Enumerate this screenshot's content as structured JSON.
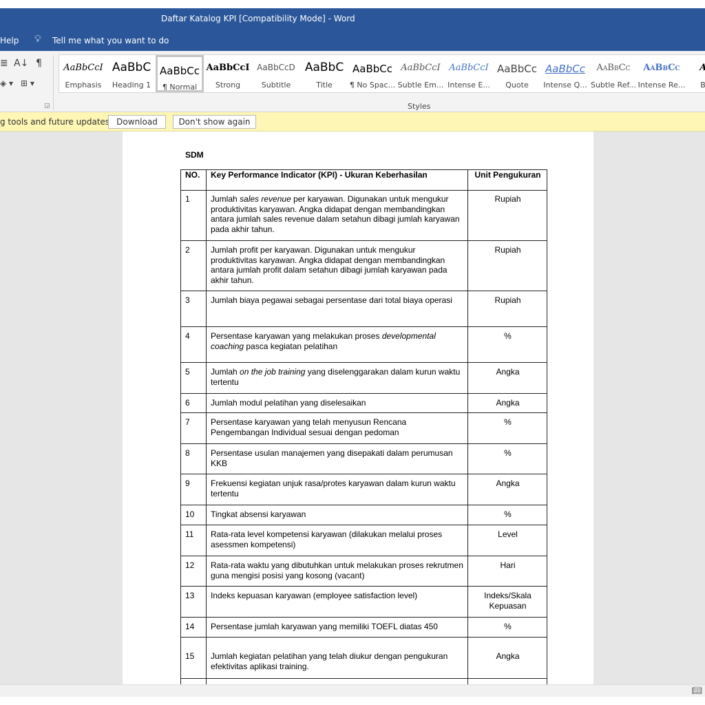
{
  "window": {
    "title": "Daftar Katalog KPI [Compatibility Mode]  -  Word"
  },
  "menu": {
    "help": "Help",
    "tell_me": "Tell me what you want to do"
  },
  "ribbon": {
    "styles_group_label": "Styles",
    "styles": [
      {
        "preview": "AaBbCcI",
        "label": "Emphasis"
      },
      {
        "preview": "AaBbC",
        "label": "Heading 1"
      },
      {
        "preview": "AaBbCc",
        "label": "¶ Normal"
      },
      {
        "preview": "AaBbCcI",
        "label": "Strong"
      },
      {
        "preview": "AaBbCcD",
        "label": "Subtitle"
      },
      {
        "preview": "AaBbC",
        "label": "Title"
      },
      {
        "preview": "AaBbCc",
        "label": "¶ No Spac..."
      },
      {
        "preview": "AaBbCcI",
        "label": "Subtle Em..."
      },
      {
        "preview": "AaBbCcI",
        "label": "Intense E..."
      },
      {
        "preview": "AaBbCc",
        "label": "Quote"
      },
      {
        "preview": "AaBbCc",
        "label": "Intense Q..."
      },
      {
        "preview": "AaBbCc",
        "label": "Subtle Ref..."
      },
      {
        "preview": "AaBbCc",
        "label": "Intense Re..."
      },
      {
        "preview": "AaB",
        "label": "Book"
      }
    ]
  },
  "infobar": {
    "message": "g tools and future updates?",
    "download": "Download",
    "dont_show": "Don't show again"
  },
  "document": {
    "heading": "SDM",
    "columns": [
      "NO.",
      "Key Performance Indicator (KPI) - Ukuran Keberhasilan",
      "Unit Pengukuran"
    ],
    "rows": [
      {
        "no": "1",
        "kpi": [
          "Jumlah ",
          "sales revenue",
          " per karyawan. Digunakan untuk mengukur produktivitas karyawan. Angka didapat dengan membandingkan antara jumlah sales revenue dalam setahun dibagi jumlah karyawan pada akhir tahun."
        ],
        "unit": "Rupiah"
      },
      {
        "no": "2",
        "kpi": [
          "Jumlah profit per karyawan. Digunakan untuk mengukur produktivitas karyawan. Angka didapat dengan membandingkan antara jumlah profit dalam setahun dibagi jumlah karyawan pada akhir tahun.",
          "",
          ""
        ],
        "unit": "Rupiah"
      },
      {
        "no": "3",
        "kpi": [
          "Jumlah biaya pegawai sebagai persentase dari total biaya operasi",
          "",
          ""
        ],
        "unit": "Rupiah"
      },
      {
        "no": "4",
        "kpi": [
          "Persentase karyawan yang melakukan proses ",
          "developmental coaching",
          " pasca kegiatan pelatihan"
        ],
        "unit": "%"
      },
      {
        "no": "5",
        "kpi": [
          "Jumlah ",
          "on the job training",
          " yang diselenggarakan dalam kurun waktu tertentu"
        ],
        "unit": "Angka"
      },
      {
        "no": "6",
        "kpi": [
          "Jumlah modul pelatihan yang diselesaikan",
          "",
          ""
        ],
        "unit": "Angka"
      },
      {
        "no": "7",
        "kpi": [
          "Persentase karyawan yang telah menyusun Rencana Pengembangan Individual sesuai dengan pedoman",
          "",
          ""
        ],
        "unit": "%"
      },
      {
        "no": "8",
        "kpi": [
          "Persentase usulan manajemen yang disepakati dalam perumusan KKB",
          "",
          ""
        ],
        "unit": "%"
      },
      {
        "no": "9",
        "kpi": [
          "Frekuensi kegiatan unjuk rasa/protes karyawan dalam kurun waktu tertentu",
          "",
          ""
        ],
        "unit": "Angka"
      },
      {
        "no": "10",
        "kpi": [
          "Tingkat absensi karyawan",
          "",
          ""
        ],
        "unit": "%"
      },
      {
        "no": "11",
        "kpi": [
          "Rata-rata level kompetensi karyawan (dilakukan melalui proses asessmen kompetensi)",
          "",
          ""
        ],
        "unit": "Level"
      },
      {
        "no": "12",
        "kpi": [
          "Rata-rata waktu yang dibutuhkan untuk melakukan proses rekrutmen guna mengisi posisi yang kosong (vacant)",
          "",
          ""
        ],
        "unit": "Hari"
      },
      {
        "no": "13",
        "kpi": [
          "Indeks kepuasan karyawan (employee satisfaction level)",
          "",
          ""
        ],
        "unit": "Indeks/Skala Kepuasan"
      },
      {
        "no": "14",
        "kpi": [
          "Persentase jumlah karyawan yang memiliki TOEFL diatas 450",
          "",
          ""
        ],
        "unit": "%"
      },
      {
        "no": "15",
        "kpi": [
          "Jumlah kegiatan pelatihan yang telah diukur dengan pengukuran efektivitas aplikasi training.",
          "",
          ""
        ],
        "unit": "Angka"
      },
      {
        "no": "",
        "kpi": [
          "",
          "",
          ""
        ],
        "unit": ""
      }
    ]
  }
}
